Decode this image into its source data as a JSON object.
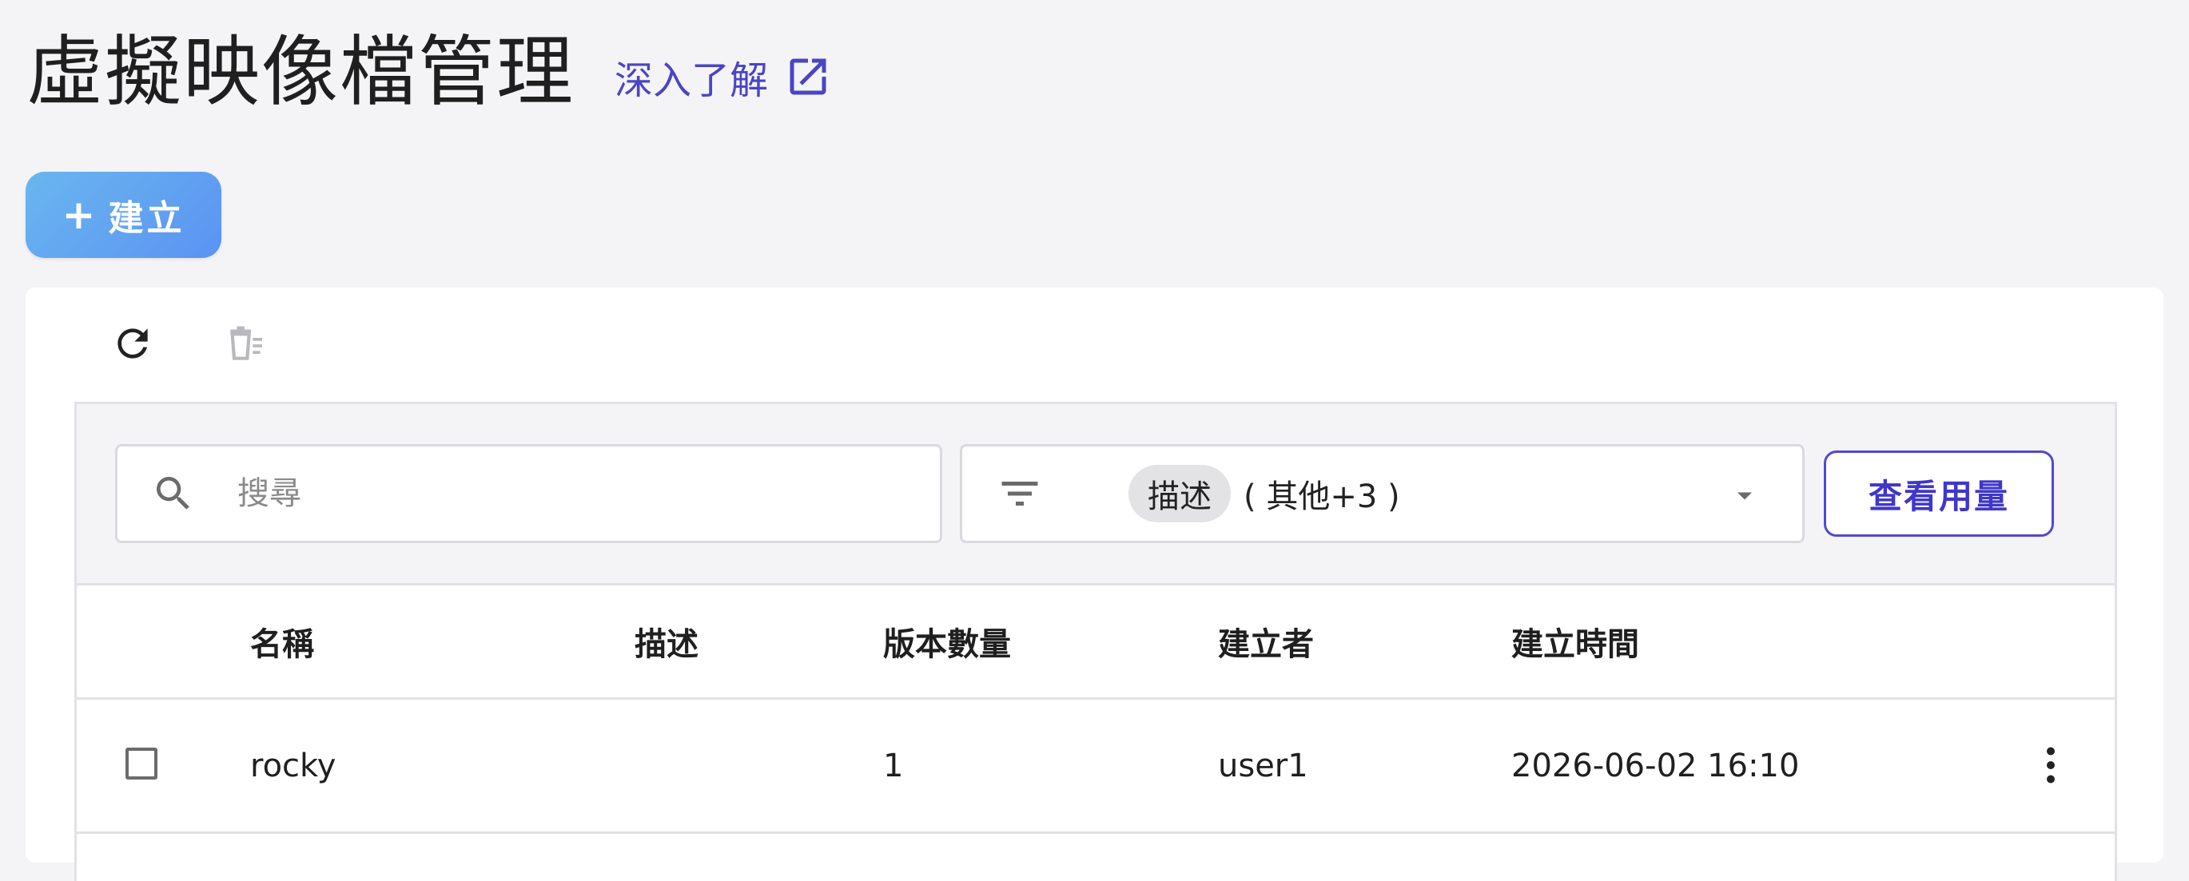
{
  "header": {
    "title": "虛擬映像檔管理",
    "learn_more": "深入了解",
    "learn_more_icon": "external-link-icon"
  },
  "create_button": {
    "icon": "+",
    "label": "建立"
  },
  "toolbar": {
    "refresh_icon": "refresh-icon",
    "bulk_delete_icon": "bulk-delete-icon"
  },
  "filter_bar": {
    "search_placeholder": "搜尋",
    "search_value": "",
    "filter_chip": "描述",
    "filter_extra": "( 其他+3 )",
    "usage_button": "查看用量"
  },
  "table": {
    "columns": [
      "名稱",
      "描述",
      "版本數量",
      "建立者",
      "建立時間"
    ],
    "rows": [
      {
        "name": "rocky",
        "description": "",
        "version_count": "1",
        "creator": "user1",
        "created_at": "2026-06-02 16:10"
      }
    ]
  },
  "colors": {
    "accent": "#4a45c4",
    "primary_button_start": "#6ab6ef",
    "primary_button_end": "#5b93f2",
    "background": "#f4f4f6"
  }
}
